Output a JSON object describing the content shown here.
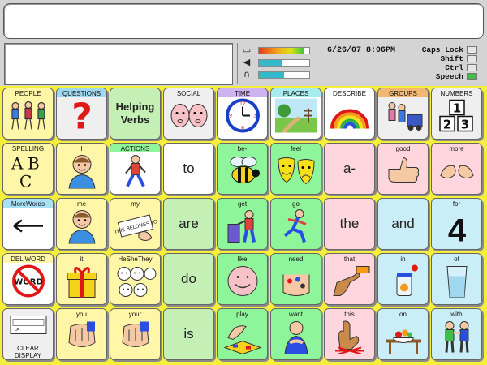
{
  "status": {
    "datetime": "6/26/07 8:06PM",
    "meters": [
      {
        "icon": "battery-icon",
        "glyph": "▭",
        "level": 0.9,
        "color": "#e05a2a"
      },
      {
        "icon": "speaker-icon",
        "glyph": "◀",
        "level": 0.45,
        "color": "#35b8c9"
      },
      {
        "icon": "headphones-icon",
        "glyph": "∩",
        "level": 0.5,
        "color": "#35b8c9"
      }
    ],
    "keys": [
      {
        "label": "Caps Lock",
        "on": false
      },
      {
        "label": "Shift",
        "on": false
      },
      {
        "label": "Ctrl",
        "on": false
      },
      {
        "label": "Speech",
        "on": true
      }
    ],
    "speech_color": "#3fbf4a"
  },
  "rows": [
    [
      {
        "name": "people",
        "label": "PEOPLE",
        "word": "",
        "bg": "c-yellow",
        "pic": "people"
      },
      {
        "name": "questions",
        "label": "QUESTIONS",
        "word": "",
        "bg": "c-lgray",
        "head": "h-blue",
        "pic": "question"
      },
      {
        "name": "helping-verbs",
        "label": "",
        "word": "Helping Verbs",
        "bg": "c-lgreen",
        "pic": ""
      },
      {
        "name": "social",
        "label": "SOCIAL",
        "word": "",
        "bg": "c-lgray",
        "pic": "social"
      },
      {
        "name": "time",
        "label": "TIME",
        "word": "",
        "bg": "c-white",
        "head": "h-purple",
        "pic": "clock"
      },
      {
        "name": "places",
        "label": "PLACES",
        "word": "",
        "bg": "c-white",
        "head": "h-cyan",
        "pic": "places"
      },
      {
        "name": "describe",
        "label": "DESCRIBE",
        "word": "",
        "bg": "c-white",
        "pic": "rainbow"
      },
      {
        "name": "groups",
        "label": "GROUPS",
        "word": "",
        "bg": "c-lgray",
        "head": "h-orange",
        "pic": "groups"
      },
      {
        "name": "numbers",
        "label": "NUMBERS",
        "word": "",
        "bg": "c-lgray",
        "pic": "numbers"
      }
    ],
    [
      {
        "name": "spelling",
        "label": "SPELLING",
        "word": "",
        "bg": "c-yellow",
        "pic": "abc"
      },
      {
        "name": "i",
        "label": "I",
        "word": "",
        "bg": "c-yellow",
        "pic": "boy"
      },
      {
        "name": "actions",
        "label": "ACTIONS",
        "word": "",
        "bg": "c-white",
        "head": "h-green",
        "pic": "walk"
      },
      {
        "name": "to",
        "label": "",
        "word": "to",
        "bg": "c-white",
        "pic": ""
      },
      {
        "name": "be",
        "label": "be-",
        "word": "",
        "bg": "c-green",
        "pic": "bee"
      },
      {
        "name": "feel",
        "label": "feel",
        "word": "",
        "bg": "c-green",
        "pic": "masks"
      },
      {
        "name": "a",
        "label": "",
        "word": "a-",
        "bg": "c-pink",
        "pic": ""
      },
      {
        "name": "good",
        "label": "good",
        "word": "",
        "bg": "c-pink",
        "pic": "thumb"
      },
      {
        "name": "more",
        "label": "more",
        "word": "",
        "bg": "c-pink",
        "pic": "hands"
      }
    ],
    [
      {
        "name": "more-words",
        "label": "MoreWords",
        "word": "",
        "bg": "c-white",
        "head": "h-lblue",
        "pic": "arrow"
      },
      {
        "name": "me",
        "label": "me",
        "word": "",
        "bg": "c-yellow",
        "pic": "boy"
      },
      {
        "name": "my",
        "label": "my",
        "word": "",
        "bg": "c-yellow",
        "pic": "tag"
      },
      {
        "name": "are",
        "label": "",
        "word": "are",
        "bg": "c-lgreen",
        "pic": ""
      },
      {
        "name": "get",
        "label": "get",
        "word": "",
        "bg": "c-green",
        "pic": "get"
      },
      {
        "name": "go",
        "label": "go",
        "word": "",
        "bg": "c-green",
        "pic": "run"
      },
      {
        "name": "the",
        "label": "",
        "word": "the",
        "bg": "c-pink",
        "pic": ""
      },
      {
        "name": "and",
        "label": "",
        "word": "and",
        "bg": "c-blue",
        "pic": ""
      },
      {
        "name": "for",
        "label": "for",
        "word": "4",
        "bg": "c-blue",
        "pic": "four"
      }
    ],
    [
      {
        "name": "del-word",
        "label": "DEL WORD",
        "word": "",
        "bg": "c-white",
        "head": "h-yellow",
        "pic": "delword"
      },
      {
        "name": "it",
        "label": "it",
        "word": "",
        "bg": "c-yellow",
        "pic": "gift"
      },
      {
        "name": "he-she-they",
        "label": "HeSheThey",
        "word": "",
        "bg": "c-yellow",
        "pic": "faces"
      },
      {
        "name": "do",
        "label": "",
        "word": "do",
        "bg": "c-lgreen",
        "pic": ""
      },
      {
        "name": "like",
        "label": "like",
        "word": "",
        "bg": "c-green",
        "pic": "smile"
      },
      {
        "name": "need",
        "label": "need",
        "word": "",
        "bg": "c-green",
        "pic": "pills"
      },
      {
        "name": "that",
        "label": "that",
        "word": "",
        "bg": "c-pink",
        "pic": "point"
      },
      {
        "name": "in",
        "label": "in",
        "word": "",
        "bg": "c-blue",
        "pic": "jar"
      },
      {
        "name": "of",
        "label": "of",
        "word": "",
        "bg": "c-blue",
        "pic": "glass"
      }
    ],
    [
      {
        "name": "clear-display",
        "label": "",
        "word": "",
        "caption": "CLEAR DISPLAY",
        "bg": "c-lgray",
        "pic": "display"
      },
      {
        "name": "you",
        "label": "you",
        "word": "",
        "bg": "c-yellow",
        "pic": "fist"
      },
      {
        "name": "your",
        "label": "your",
        "word": "",
        "bg": "c-yellow",
        "pic": "fist"
      },
      {
        "name": "is",
        "label": "",
        "word": "is",
        "bg": "c-lgreen",
        "pic": ""
      },
      {
        "name": "play",
        "label": "play",
        "word": "",
        "bg": "c-green",
        "pic": "play"
      },
      {
        "name": "want",
        "label": "want",
        "word": "",
        "bg": "c-green",
        "pic": "want"
      },
      {
        "name": "this",
        "label": "this",
        "word": "",
        "bg": "c-pink",
        "pic": "this"
      },
      {
        "name": "on",
        "label": "on",
        "word": "",
        "bg": "c-blue",
        "pic": "table"
      },
      {
        "name": "with",
        "label": "with",
        "word": "",
        "bg": "c-blue",
        "pic": "pair"
      }
    ]
  ]
}
